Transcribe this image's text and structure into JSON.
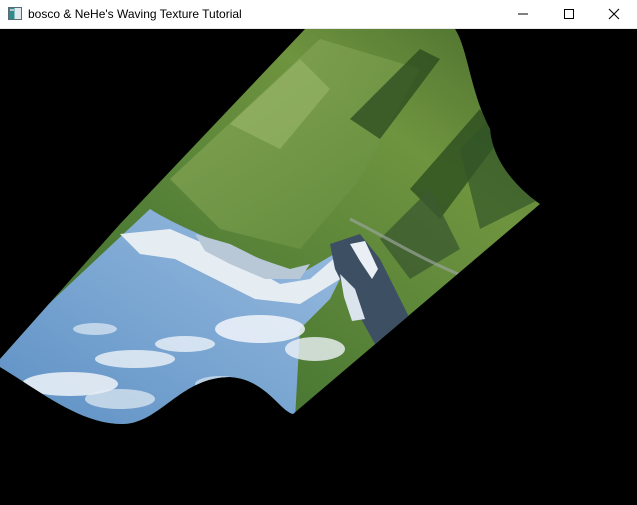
{
  "window": {
    "title": "bosco & NeHe's Waving Texture Tutorial",
    "icon": "app-window-icon",
    "controls": {
      "minimize": "minimize-icon",
      "maximize": "maximize-icon",
      "close": "close-icon"
    }
  },
  "scene": {
    "background_color": "#000000",
    "texture_colors": {
      "sky": "#6d9ccb",
      "cloud": "#eef3f8",
      "snow": "#e6edf2",
      "rock": "#3c4f63",
      "forest": "#3f6a2c",
      "meadow": "#7fa24a"
    }
  }
}
